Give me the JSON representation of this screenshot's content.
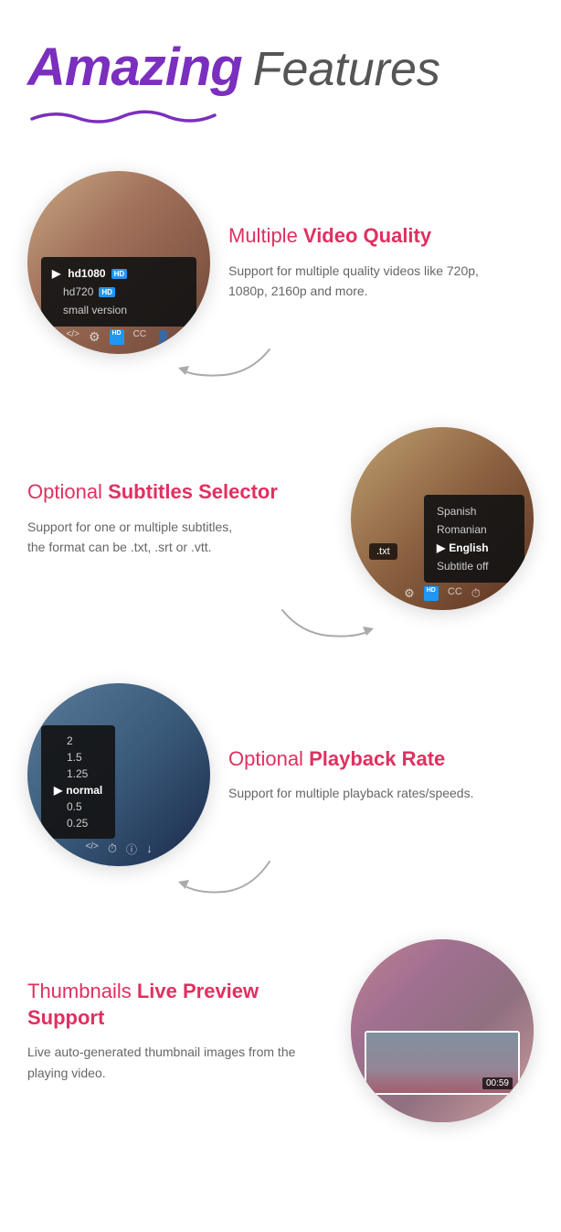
{
  "header": {
    "amazing": "Amazing",
    "features": "Features"
  },
  "feature1": {
    "title_normal": "Multiple ",
    "title_bold": "Video Quality",
    "description": "Support for multiple quality videos like 720p, 1080p, 2160p and more.",
    "dropdown": {
      "items": [
        {
          "label": "hd1080",
          "badge": "HD",
          "active": true
        },
        {
          "label": "hd720",
          "badge": "HD",
          "active": false
        },
        {
          "label": "small version",
          "badge": "",
          "active": false
        }
      ]
    }
  },
  "feature2": {
    "title_normal": "Optional ",
    "title_bold": "Subtitles Selector",
    "description_line1": "Support for one or multiple subtitles,",
    "description_line2": "the format can be .txt, .srt or .vtt.",
    "dropdown": {
      "items": [
        {
          "label": "Spanish",
          "active": false
        },
        {
          "label": "Romanian",
          "active": false
        },
        {
          "label": "English",
          "active": true
        },
        {
          "label": "Subtitle off",
          "active": false
        }
      ]
    },
    "txt_label": ".txt"
  },
  "feature3": {
    "title_normal": "Optional ",
    "title_bold": "Playback Rate",
    "description": "Support for multiple playback rates/speeds.",
    "dropdown": {
      "items": [
        {
          "label": "2",
          "active": false
        },
        {
          "label": "1.5",
          "active": false
        },
        {
          "label": "1.25",
          "active": false
        },
        {
          "label": "normal",
          "active": true
        },
        {
          "label": "0.5",
          "active": false
        },
        {
          "label": "0.25",
          "active": false
        }
      ]
    }
  },
  "feature4": {
    "title_normal": "Thumbnails ",
    "title_bold": "Live Preview Support",
    "description": "Live auto-generated thumbnail images from the playing video.",
    "time_badge": "00:59"
  }
}
